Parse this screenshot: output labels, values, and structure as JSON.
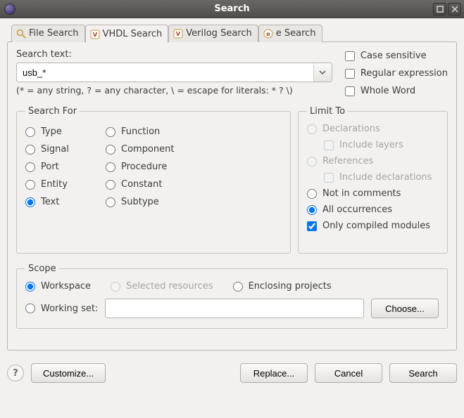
{
  "title": "Search",
  "tabs": [
    {
      "label": "File Search"
    },
    {
      "label": "VHDL Search"
    },
    {
      "label": "Verilog Search"
    },
    {
      "label": "e Search"
    }
  ],
  "activeTab": 1,
  "searchText": {
    "label": "Search text:",
    "value": "usb_*",
    "hint": "(* = any string, ? = any character, \\ = escape for literals: * ? \\)"
  },
  "options": {
    "caseSensitive": {
      "label": "Case sensitive",
      "checked": false
    },
    "regex": {
      "label": "Regular expression",
      "checked": false
    },
    "wholeWord": {
      "label": "Whole Word",
      "checked": false
    }
  },
  "searchFor": {
    "legend": "Search For",
    "selected": "text",
    "items": [
      {
        "id": "type",
        "label": "Type"
      },
      {
        "id": "function",
        "label": "Function"
      },
      {
        "id": "signal",
        "label": "Signal"
      },
      {
        "id": "component",
        "label": "Component"
      },
      {
        "id": "port",
        "label": "Port"
      },
      {
        "id": "procedure",
        "label": "Procedure"
      },
      {
        "id": "entity",
        "label": "Entity"
      },
      {
        "id": "constant",
        "label": "Constant"
      },
      {
        "id": "text",
        "label": "Text"
      },
      {
        "id": "subtype",
        "label": "Subtype"
      }
    ]
  },
  "limitTo": {
    "legend": "Limit To",
    "declarations": {
      "label": "Declarations",
      "enabled": false
    },
    "includeLayers": {
      "label": "Include layers",
      "enabled": false,
      "checked": false
    },
    "references": {
      "label": "References",
      "enabled": false
    },
    "includeDecls": {
      "label": "Include declarations",
      "enabled": false,
      "checked": false
    },
    "notInComments": {
      "label": "Not in comments",
      "enabled": true
    },
    "allOccurrences": {
      "label": "All occurrences",
      "enabled": true
    },
    "selected": "allOccurrences",
    "onlyCompiled": {
      "label": "Only compiled modules",
      "checked": true
    }
  },
  "scope": {
    "legend": "Scope",
    "workspace": "Workspace",
    "selectedResources": "Selected resources",
    "enclosing": "Enclosing projects",
    "workingSet": "Working set:",
    "workingSetValue": "",
    "choose": "Choose...",
    "selected": "workspace",
    "selectedResourcesEnabled": false
  },
  "buttons": {
    "customize": "Customize...",
    "replace": "Replace...",
    "cancel": "Cancel",
    "search": "Search"
  },
  "help": "?"
}
